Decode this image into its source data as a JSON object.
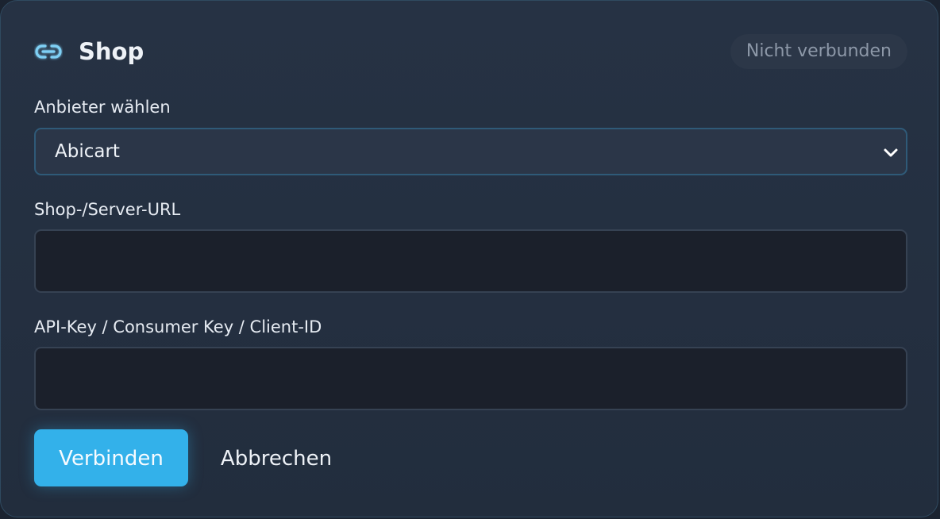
{
  "header": {
    "title": "Shop",
    "icon": "link-icon",
    "status": "Nicht verbunden"
  },
  "form": {
    "provider": {
      "label": "Anbieter wählen",
      "selected": "Abicart"
    },
    "url": {
      "label": "Shop-/Server-URL",
      "value": ""
    },
    "api_key": {
      "label": "API-Key / Consumer Key / Client-ID",
      "value": ""
    }
  },
  "actions": {
    "connect_label": "Verbinden",
    "cancel_label": "Abbrechen"
  },
  "colors": {
    "accent": "#33b1ea",
    "panel_bg": "#263244",
    "input_bg": "#1b202b"
  }
}
